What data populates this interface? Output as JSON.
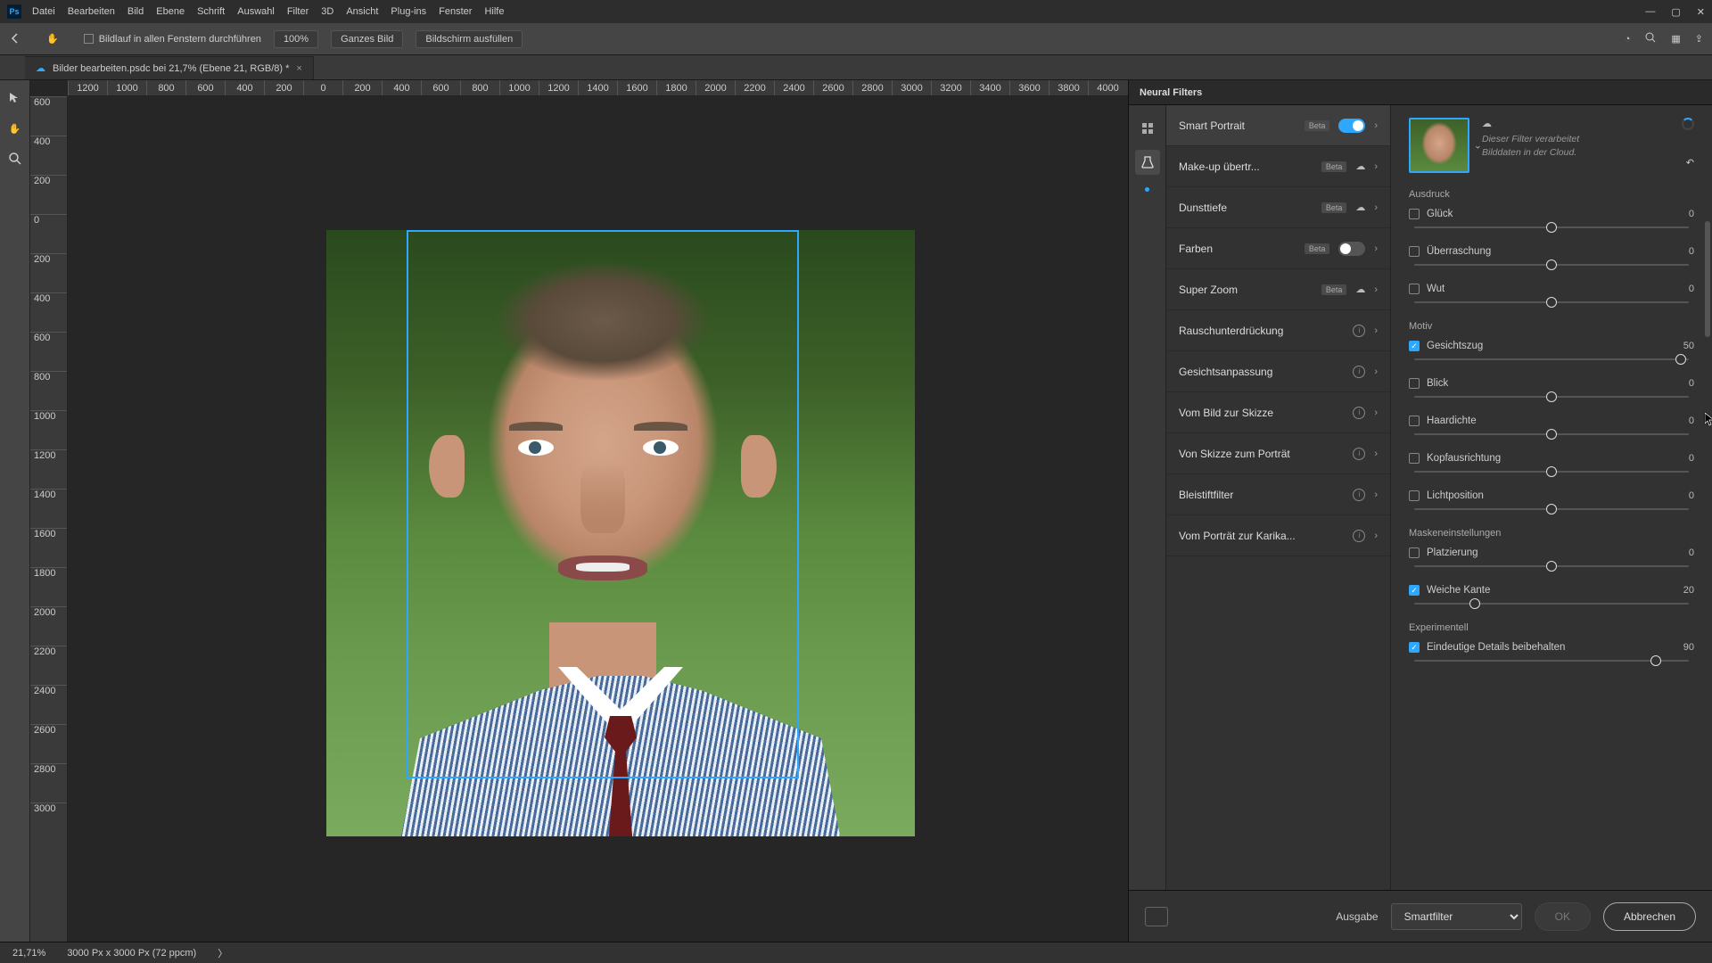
{
  "menu": [
    "Datei",
    "Bearbeiten",
    "Bild",
    "Ebene",
    "Schrift",
    "Auswahl",
    "Filter",
    "3D",
    "Ansicht",
    "Plug-ins",
    "Fenster",
    "Hilfe"
  ],
  "optbar": {
    "scroll_all": "Bildlauf in allen Fenstern durchführen",
    "zoom": "100%",
    "fit": "Ganzes Bild",
    "fill": "Bildschirm ausfüllen"
  },
  "doc_tab": "Bilder bearbeiten.psdc bei 21,7% (Ebene 21, RGB/8) *",
  "ruler_h": [
    "1200",
    "1000",
    "800",
    "600",
    "400",
    "200",
    "0",
    "200",
    "400",
    "600",
    "800",
    "1000",
    "1200",
    "1400",
    "1600",
    "1800",
    "2000",
    "2200",
    "2400",
    "2600",
    "2800",
    "3000",
    "3200",
    "3400",
    "3600",
    "3800",
    "4000"
  ],
  "ruler_v": [
    "600",
    "400",
    "200",
    "0",
    "200",
    "400",
    "600",
    "800",
    "1000",
    "1200",
    "1400",
    "1600",
    "1800",
    "2000",
    "2200",
    "2400",
    "2600",
    "2800",
    "3000"
  ],
  "nf_title": "Neural Filters",
  "filters": [
    {
      "name": "Smart Portrait",
      "beta": true,
      "icon": "toggle-on",
      "active": true
    },
    {
      "name": "Make-up übertr...",
      "beta": true,
      "icon": "cloud-dl"
    },
    {
      "name": "Dunsttiefe",
      "beta": true,
      "icon": "cloud-dl"
    },
    {
      "name": "Farben",
      "beta": true,
      "icon": "toggle-off"
    },
    {
      "name": "Super Zoom",
      "beta": true,
      "icon": "cloud-dl"
    },
    {
      "name": "Rauschunterdrückung",
      "icon": "info"
    },
    {
      "name": "Gesichtsanpassung",
      "icon": "info"
    },
    {
      "name": "Vom Bild zur Skizze",
      "icon": "info"
    },
    {
      "name": "Von Skizze zum Porträt",
      "icon": "info"
    },
    {
      "name": "Bleistiftfilter",
      "icon": "info"
    },
    {
      "name": "Vom Porträt zur Karika...",
      "icon": "info"
    }
  ],
  "info_text": "Dieser Filter verarbeitet Bilddaten in der Cloud.",
  "sections": {
    "ausdruck": {
      "title": "Ausdruck",
      "items": [
        {
          "label": "Glück",
          "value": 0,
          "checked": false,
          "pos": 50
        },
        {
          "label": "Überraschung",
          "value": 0,
          "checked": false,
          "pos": 50
        },
        {
          "label": "Wut",
          "value": 0,
          "checked": false,
          "pos": 50
        }
      ]
    },
    "motiv": {
      "title": "Motiv",
      "items": [
        {
          "label": "Gesichtszug",
          "value": 50,
          "checked": true,
          "pos": 97
        },
        {
          "label": "Blick",
          "value": 0,
          "checked": false,
          "pos": 50
        },
        {
          "label": "Haardichte",
          "value": 0,
          "checked": false,
          "pos": 50
        },
        {
          "label": "Kopfausrichtung",
          "value": 0,
          "checked": false,
          "pos": 50
        },
        {
          "label": "Lichtposition",
          "value": 0,
          "checked": false,
          "pos": 50
        }
      ]
    },
    "mask": {
      "title": "Maskeneinstellungen",
      "items": [
        {
          "label": "Platzierung",
          "value": 0,
          "checked": false,
          "pos": 50
        },
        {
          "label": "Weiche Kante",
          "value": 20,
          "checked": true,
          "pos": 22
        }
      ]
    },
    "exp": {
      "title": "Experimentell",
      "items": [
        {
          "label": "Eindeutige Details beibehalten",
          "value": 90,
          "checked": true,
          "pos": 88
        }
      ]
    }
  },
  "bottom": {
    "ausgabe": "Ausgabe",
    "output": "Smartfilter",
    "ok": "OK",
    "cancel": "Abbrechen"
  },
  "status": {
    "zoom": "21,71%",
    "dims": "3000 Px x 3000 Px (72 ppcm)"
  }
}
